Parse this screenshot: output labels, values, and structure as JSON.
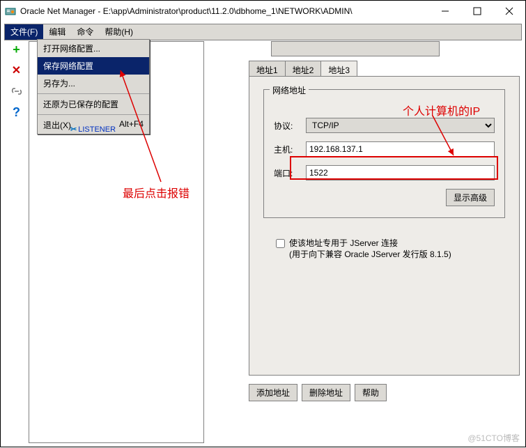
{
  "window": {
    "title": "Oracle Net Manager - E:\\app\\Administrator\\product\\11.2.0\\dbhome_1\\NETWORK\\ADMIN\\"
  },
  "menubar": {
    "file": "文件(F)",
    "edit": "编辑",
    "command": "命令",
    "help": "帮助(H)"
  },
  "filemenu": {
    "open": "打开网络配置...",
    "save": "保存网络配置",
    "saveas": "另存为...",
    "revert": "还原为已保存的配置",
    "exit": "退出(X)",
    "exit_accel": "Alt+F4"
  },
  "tree": {
    "listener": "LISTENER"
  },
  "tabs": {
    "t1": "地址1",
    "t2": "地址2",
    "t3": "地址3"
  },
  "group": {
    "legend": "网络地址",
    "protocol_label": "协议:",
    "protocol_value": "TCP/IP",
    "host_label": "主机:",
    "host_value": "192.168.137.1",
    "port_label": "端口:",
    "port_value": "1522",
    "advanced": "显示高级"
  },
  "jserver": {
    "line1": "使该地址专用于 JServer 连接",
    "line2": "(用于向下兼容 Oracle JServer 发行版 8.1.5)"
  },
  "bottom": {
    "add": "添加地址",
    "del": "删除地址",
    "help": "帮助"
  },
  "annotations": {
    "ip": "个人计算机的IP",
    "err": "最后点击报错"
  },
  "watermark": "@51CTO博客"
}
